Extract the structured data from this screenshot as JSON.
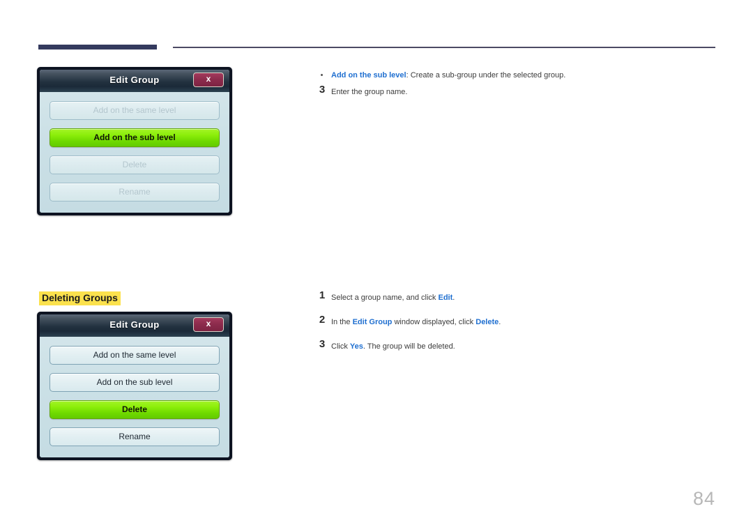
{
  "page": {
    "number": "84"
  },
  "header": {
    "rule_thick_color": "#343a5e",
    "rule_thin_color": "#4c4a63"
  },
  "section": {
    "heading": "Deleting Groups",
    "heading_highlight_color": "#fbe14d"
  },
  "dialogs": [
    {
      "id": "edit-group-sub-level",
      "title": "Edit Group",
      "close_label": "x",
      "buttons": [
        {
          "label": "Add on the same level",
          "state": "disabled"
        },
        {
          "label": "Add on the sub level",
          "state": "selected"
        },
        {
          "label": "Delete",
          "state": "disabled"
        },
        {
          "label": "Rename",
          "state": "disabled"
        }
      ]
    },
    {
      "id": "edit-group-delete",
      "title": "Edit Group",
      "close_label": "x",
      "buttons": [
        {
          "label": "Add on the same level",
          "state": "normal"
        },
        {
          "label": "Add on the sub level",
          "state": "normal"
        },
        {
          "label": "Delete",
          "state": "selected"
        },
        {
          "label": "Rename",
          "state": "normal"
        }
      ]
    }
  ],
  "content": {
    "bullet_sub_level": {
      "term": "Add on the sub level",
      "body": ": Create a sub-group under the selected group."
    },
    "step_3_top": {
      "number": "3",
      "text": "Enter the group name."
    },
    "step_1": {
      "number": "1",
      "text_before": "Select a group name, and click ",
      "em": "Edit",
      "text_after": "."
    },
    "step_2": {
      "number": "2",
      "text_before": "In the ",
      "em1": "Edit Group",
      "text_middle": " window displayed, click ",
      "em2": "Delete",
      "text_after": "."
    },
    "step_3_bottom": {
      "number": "3",
      "text_before": "Click ",
      "em": "Yes",
      "text_after": ". The group will be deleted."
    }
  },
  "colors": {
    "accent_blue": "#1f6fd0",
    "selected_green": "#8bee0a",
    "close_button_maroon": "#8d2c4d",
    "dialog_body": "#c5dce3",
    "dialog_frame": "#0d1321"
  }
}
